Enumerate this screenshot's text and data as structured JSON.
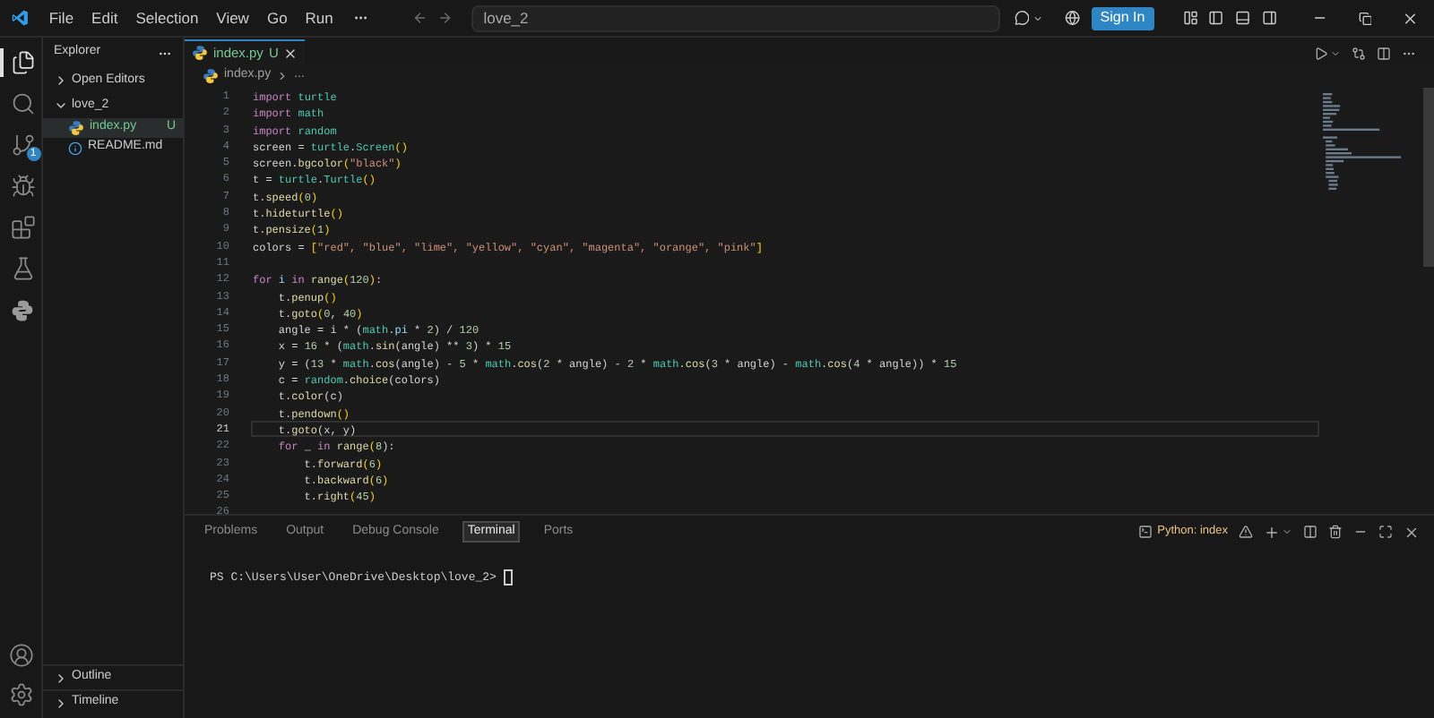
{
  "title_bar": {
    "menus": [
      "File",
      "Edit",
      "Selection",
      "View",
      "Go",
      "Run"
    ],
    "search": {
      "value": "love_2"
    },
    "sign_in": "Sign In"
  },
  "activity_bar": {
    "items": [
      {
        "kind": "explorer",
        "selected": true
      },
      {
        "kind": "search",
        "selected": false
      },
      {
        "kind": "source-control",
        "selected": false,
        "badge": "1"
      },
      {
        "kind": "run-debug",
        "selected": false
      },
      {
        "kind": "extensions",
        "selected": false
      },
      {
        "kind": "testing",
        "selected": false
      },
      {
        "kind": "python",
        "selected": false
      }
    ],
    "bottom": [
      {
        "kind": "account"
      },
      {
        "kind": "settings"
      }
    ]
  },
  "sidebar": {
    "title": "Explorer",
    "sections": [
      {
        "label": "Open Editors",
        "expanded": false
      },
      {
        "label": "love_2",
        "expanded": true,
        "children": [
          {
            "name": "index.py",
            "kind": "python",
            "status": "U",
            "selected": true
          },
          {
            "name": "README.md",
            "kind": "info",
            "selected": false
          }
        ]
      }
    ],
    "bottom_sections": [
      {
        "label": "Outline",
        "expanded": false
      },
      {
        "label": "Timeline",
        "expanded": false
      }
    ]
  },
  "editor": {
    "tabs": [
      {
        "label": "index.py",
        "status": "U",
        "selected": true
      }
    ],
    "breadcrumb": [
      "index.py",
      "..."
    ],
    "lines": [
      {
        "number": "1",
        "current": false,
        "tokens": [
          {
            "text": "import ",
            "kind": "kw"
          },
          {
            "text": "turtle",
            "kind": "mod"
          }
        ]
      },
      {
        "number": "2",
        "current": false,
        "tokens": [
          {
            "text": "import ",
            "kind": "kw"
          },
          {
            "text": "math",
            "kind": "mod"
          }
        ]
      },
      {
        "number": "3",
        "current": false,
        "tokens": [
          {
            "text": "import ",
            "kind": "kw"
          },
          {
            "text": "random",
            "kind": "mod"
          }
        ]
      },
      {
        "number": "4",
        "current": false,
        "tokens": [
          {
            "text": "screen = ",
            "kind": "text"
          },
          {
            "text": "turtle",
            "kind": "mod"
          },
          {
            "text": ".",
            "kind": "text"
          },
          {
            "text": "Screen",
            "kind": "mod"
          },
          {
            "text": "()",
            "kind": "paren"
          }
        ]
      },
      {
        "number": "5",
        "current": false,
        "tokens": [
          {
            "text": "screen.",
            "kind": "text"
          },
          {
            "text": "bgcolor",
            "kind": "fn"
          },
          {
            "text": "(",
            "kind": "paren"
          },
          {
            "text": "\"black\"",
            "kind": "str"
          },
          {
            "text": ")",
            "kind": "paren"
          }
        ]
      },
      {
        "number": "6",
        "current": false,
        "tokens": [
          {
            "text": "t = ",
            "kind": "text"
          },
          {
            "text": "turtle",
            "kind": "mod"
          },
          {
            "text": ".",
            "kind": "text"
          },
          {
            "text": "Turtle",
            "kind": "mod"
          },
          {
            "text": "()",
            "kind": "paren"
          }
        ]
      },
      {
        "number": "7",
        "current": false,
        "tokens": [
          {
            "text": "t.",
            "kind": "text"
          },
          {
            "text": "speed",
            "kind": "fn"
          },
          {
            "text": "(",
            "kind": "paren"
          },
          {
            "text": "0",
            "kind": "num"
          },
          {
            "text": ")",
            "kind": "paren"
          }
        ]
      },
      {
        "number": "8",
        "current": false,
        "tokens": [
          {
            "text": "t.",
            "kind": "text"
          },
          {
            "text": "hideturtle",
            "kind": "fn"
          },
          {
            "text": "()",
            "kind": "paren"
          }
        ]
      },
      {
        "number": "9",
        "current": false,
        "tokens": [
          {
            "text": "t.",
            "kind": "text"
          },
          {
            "text": "pensize",
            "kind": "fn"
          },
          {
            "text": "(",
            "kind": "paren"
          },
          {
            "text": "1",
            "kind": "num"
          },
          {
            "text": ")",
            "kind": "paren"
          }
        ]
      },
      {
        "number": "10",
        "current": false,
        "tokens": [
          {
            "text": "colors = ",
            "kind": "text"
          },
          {
            "text": "[",
            "kind": "paren"
          },
          {
            "text": "\"red\", \"blue\", \"lime\", \"yellow\", \"cyan\", \"magenta\", \"orange\", \"pink\"",
            "kind": "str"
          },
          {
            "text": "]",
            "kind": "paren"
          }
        ]
      },
      {
        "number": "11",
        "current": false
      },
      {
        "number": "12",
        "current": false,
        "tokens": [
          {
            "text": "for",
            "kind": "kw"
          },
          {
            "text": " i ",
            "kind": "var"
          },
          {
            "text": "in ",
            "kind": "kw"
          },
          {
            "text": "range",
            "kind": "fn"
          },
          {
            "text": "(",
            "kind": "paren"
          },
          {
            "text": "120",
            "kind": "num"
          },
          {
            "text": ")",
            "kind": "paren"
          },
          {
            "text": ":",
            "kind": "text"
          }
        ]
      },
      {
        "number": "13",
        "current": false,
        "tokens": [
          {
            "text": "    t.",
            "kind": "text"
          },
          {
            "text": "penup",
            "kind": "fn"
          },
          {
            "text": "()",
            "kind": "paren"
          }
        ]
      },
      {
        "number": "14",
        "current": false,
        "tokens": [
          {
            "text": "    t.",
            "kind": "text"
          },
          {
            "text": "goto",
            "kind": "fn"
          },
          {
            "text": "(",
            "kind": "paren"
          },
          {
            "text": "0",
            "kind": "num"
          },
          {
            "text": ", ",
            "kind": "text"
          },
          {
            "text": "40",
            "kind": "num"
          },
          {
            "text": ")",
            "kind": "paren"
          }
        ]
      },
      {
        "number": "15",
        "current": false,
        "tokens": [
          {
            "text": "    angle = i * (",
            "kind": "text"
          },
          {
            "text": "math",
            "kind": "mod"
          },
          {
            "text": ".",
            "kind": "text"
          },
          {
            "text": "pi",
            "kind": "var"
          },
          {
            "text": " * ",
            "kind": "text"
          },
          {
            "text": "2",
            "kind": "num"
          },
          {
            "text": ") / ",
            "kind": "text"
          },
          {
            "text": "120",
            "kind": "num"
          }
        ]
      },
      {
        "number": "16",
        "current": false,
        "tokens": [
          {
            "text": "    x = ",
            "kind": "text"
          },
          {
            "text": "16",
            "kind": "num"
          },
          {
            "text": " * (",
            "kind": "text"
          },
          {
            "text": "math",
            "kind": "mod"
          },
          {
            "text": ".",
            "kind": "text"
          },
          {
            "text": "sin",
            "kind": "fn"
          },
          {
            "text": "(angle) ** ",
            "kind": "text"
          },
          {
            "text": "3",
            "kind": "num"
          },
          {
            "text": ") * ",
            "kind": "text"
          },
          {
            "text": "15",
            "kind": "num"
          }
        ]
      },
      {
        "number": "17",
        "current": false,
        "tokens": [
          {
            "text": "    y = (",
            "kind": "text"
          },
          {
            "text": "13",
            "kind": "num"
          },
          {
            "text": " * ",
            "kind": "text"
          },
          {
            "text": "math",
            "kind": "mod"
          },
          {
            "text": ".",
            "kind": "text"
          },
          {
            "text": "cos",
            "kind": "fn"
          },
          {
            "text": "(angle) - ",
            "kind": "text"
          },
          {
            "text": "5",
            "kind": "num"
          },
          {
            "text": " * ",
            "kind": "text"
          },
          {
            "text": "math",
            "kind": "mod"
          },
          {
            "text": ".",
            "kind": "text"
          },
          {
            "text": "cos",
            "kind": "fn"
          },
          {
            "text": "(",
            "kind": "text"
          },
          {
            "text": "2",
            "kind": "num"
          },
          {
            "text": " * angle) - ",
            "kind": "text"
          },
          {
            "text": "2",
            "kind": "num"
          },
          {
            "text": " * ",
            "kind": "text"
          },
          {
            "text": "math",
            "kind": "mod"
          },
          {
            "text": ".",
            "kind": "text"
          },
          {
            "text": "cos",
            "kind": "fn"
          },
          {
            "text": "(",
            "kind": "text"
          },
          {
            "text": "3",
            "kind": "num"
          },
          {
            "text": " * angle) - ",
            "kind": "text"
          },
          {
            "text": "math",
            "kind": "mod"
          },
          {
            "text": ".",
            "kind": "text"
          },
          {
            "text": "cos",
            "kind": "fn"
          },
          {
            "text": "(",
            "kind": "text"
          },
          {
            "text": "4",
            "kind": "num"
          },
          {
            "text": " * angle)) * ",
            "kind": "text"
          },
          {
            "text": "15",
            "kind": "num"
          }
        ]
      },
      {
        "number": "18",
        "current": false,
        "tokens": [
          {
            "text": "    c = ",
            "kind": "text"
          },
          {
            "text": "random",
            "kind": "mod"
          },
          {
            "text": ".",
            "kind": "text"
          },
          {
            "text": "choice",
            "kind": "fn"
          },
          {
            "text": "(colors)",
            "kind": "text"
          }
        ]
      },
      {
        "number": "19",
        "current": false,
        "tokens": [
          {
            "text": "    t.",
            "kind": "text"
          },
          {
            "text": "color",
            "kind": "fn"
          },
          {
            "text": "(c)",
            "kind": "text"
          }
        ]
      },
      {
        "number": "20",
        "current": false,
        "tokens": [
          {
            "text": "    t.",
            "kind": "text"
          },
          {
            "text": "pendown",
            "kind": "fn"
          },
          {
            "text": "()",
            "kind": "paren"
          }
        ]
      },
      {
        "number": "21",
        "current": true,
        "tokens": [
          {
            "text": "    t.",
            "kind": "text"
          },
          {
            "text": "goto",
            "kind": "fn"
          },
          {
            "text": "(x, y)",
            "kind": "text"
          }
        ]
      },
      {
        "number": "22",
        "current": false,
        "tokens": [
          {
            "text": "    for",
            "kind": "kw"
          },
          {
            "text": " _ ",
            "kind": "text"
          },
          {
            "text": "in ",
            "kind": "kw"
          },
          {
            "text": "range",
            "kind": "fn"
          },
          {
            "text": "(",
            "kind": "paren"
          },
          {
            "text": "8",
            "kind": "num"
          },
          {
            "text": "):",
            "kind": "text"
          }
        ]
      },
      {
        "number": "23",
        "current": false,
        "tokens": [
          {
            "text": "        t.",
            "kind": "text"
          },
          {
            "text": "forward",
            "kind": "fn"
          },
          {
            "text": "(",
            "kind": "paren"
          },
          {
            "text": "6",
            "kind": "num"
          },
          {
            "text": ")",
            "kind": "paren"
          }
        ]
      },
      {
        "number": "24",
        "current": false,
        "tokens": [
          {
            "text": "        t.",
            "kind": "text"
          },
          {
            "text": "backward",
            "kind": "fn"
          },
          {
            "text": "(",
            "kind": "paren"
          },
          {
            "text": "6",
            "kind": "num"
          },
          {
            "text": ")",
            "kind": "paren"
          }
        ]
      },
      {
        "number": "25",
        "current": false,
        "tokens": [
          {
            "text": "        t.",
            "kind": "text"
          },
          {
            "text": "right",
            "kind": "fn"
          },
          {
            "text": "(",
            "kind": "paren"
          },
          {
            "text": "45",
            "kind": "num"
          },
          {
            "text": ")",
            "kind": "paren"
          }
        ]
      },
      {
        "number": "26",
        "current": false
      }
    ]
  },
  "panel": {
    "tabs": [
      {
        "label": "Problems",
        "selected": false
      },
      {
        "label": "Output",
        "selected": false
      },
      {
        "label": "Debug Console",
        "selected": false
      },
      {
        "label": "Terminal",
        "selected": true
      },
      {
        "label": "Ports",
        "selected": false
      }
    ],
    "terminal_name": "Python: index",
    "prompt": "PS C:\\Users\\User\\OneDrive\\Desktop\\love_2> "
  }
}
